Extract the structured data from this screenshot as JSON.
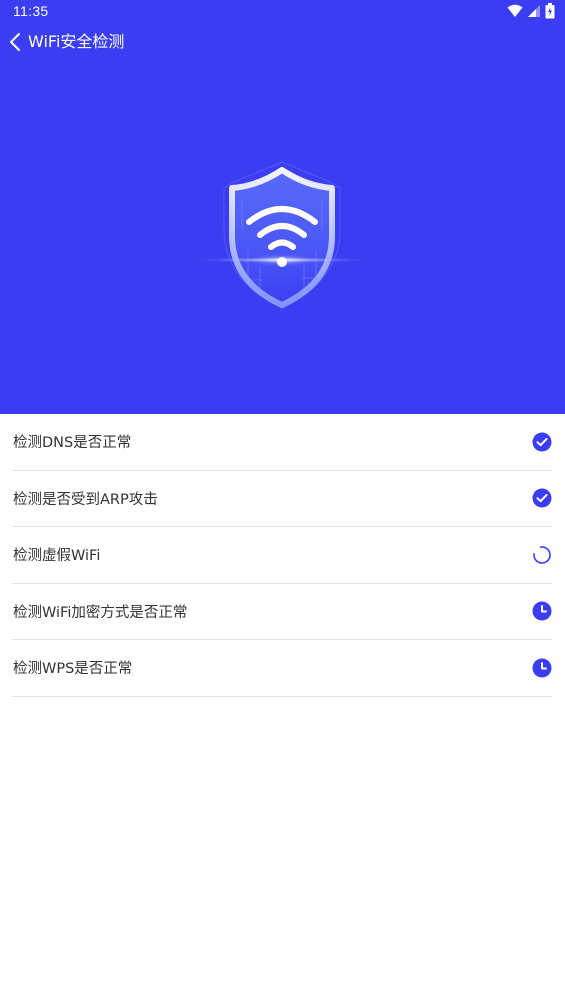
{
  "status_bar": {
    "time": "11:35"
  },
  "header": {
    "title": "WiFi安全检测"
  },
  "checks": [
    {
      "label": "检测DNS是否正常",
      "state": "done",
      "icon": "check-circle-icon"
    },
    {
      "label": "检测是否受到ARP攻击",
      "state": "done",
      "icon": "check-circle-icon"
    },
    {
      "label": "检测虚假WiFi",
      "state": "in-progress",
      "icon": "spinner-icon"
    },
    {
      "label": "检测WiFi加密方式是否正常",
      "state": "pending",
      "icon": "clock-icon"
    },
    {
      "label": "检测WPS是否正常",
      "state": "pending",
      "icon": "clock-icon"
    }
  ],
  "colors": {
    "accent": "#3a3df2",
    "icon_blue": "#3a3df2",
    "divider": "#e3e3e3",
    "text": "#333333"
  }
}
